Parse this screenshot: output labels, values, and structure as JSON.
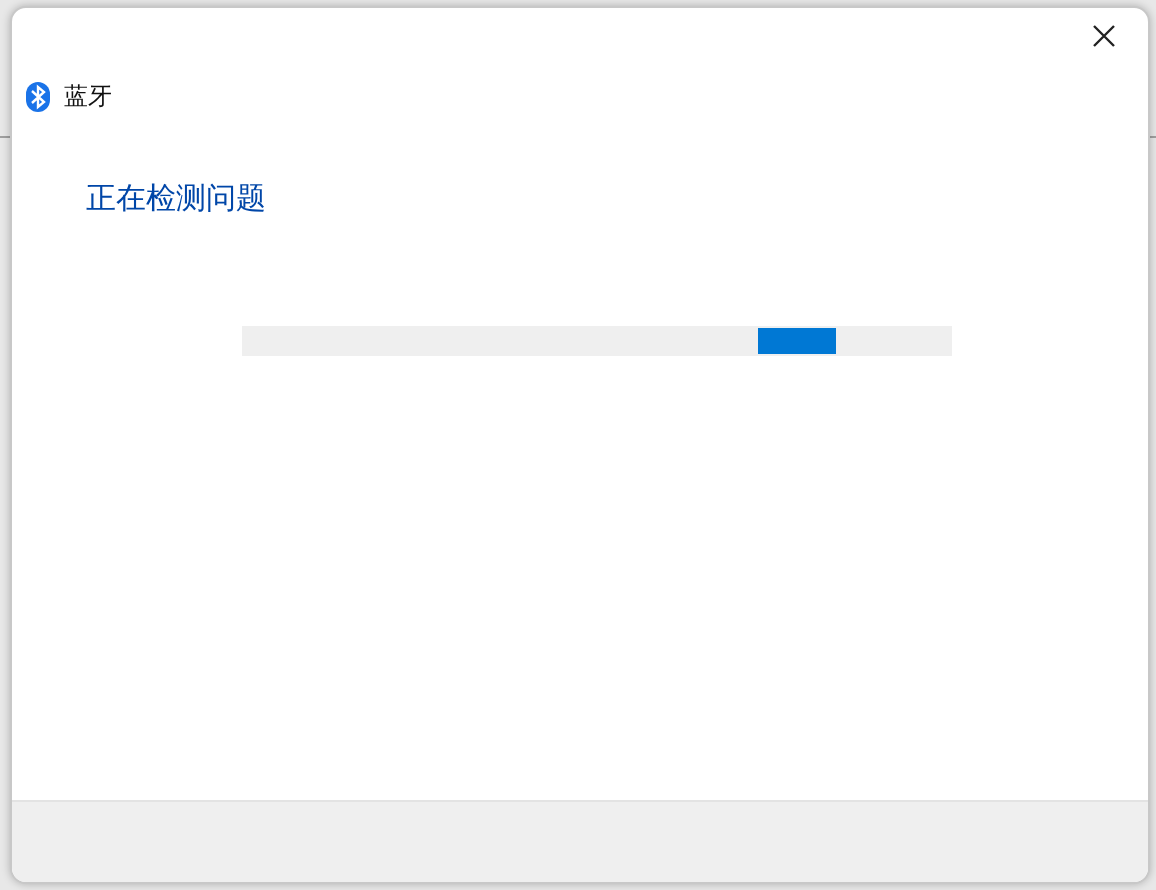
{
  "window": {
    "title": "蓝牙"
  },
  "heading": "正在检测问题",
  "progress": {
    "indeterminate": true
  }
}
